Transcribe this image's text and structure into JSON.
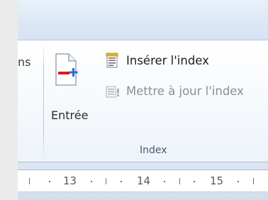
{
  "ribbon": {
    "prev_group_label_fragment": "ns",
    "entree_label": "Entrée",
    "insert_index_label": "Insérer l'index",
    "update_index_label": "Mettre à jour l'index",
    "group_label": "Index"
  },
  "ruler": {
    "numbers": [
      "13",
      "14",
      "15"
    ]
  },
  "icons": {
    "entree": "mark-entry-icon",
    "insert_index": "insert-index-icon",
    "update_index": "update-index-icon"
  }
}
